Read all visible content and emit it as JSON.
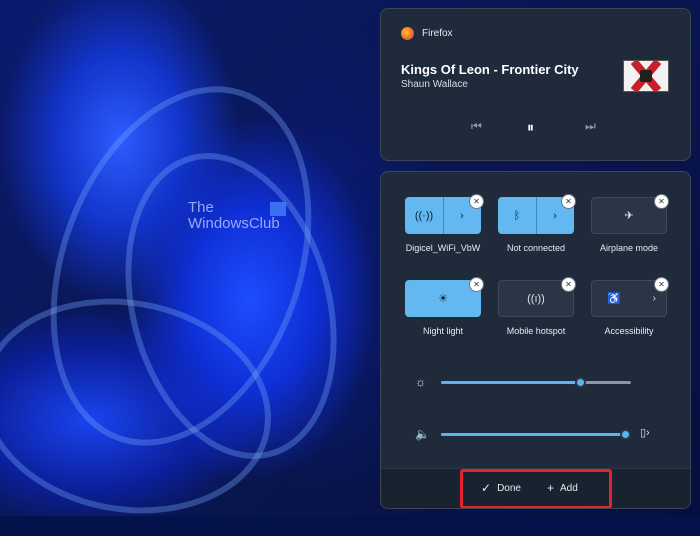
{
  "watermark": {
    "line1": "The",
    "line2": "WindowsClub"
  },
  "media": {
    "app_name": "Firefox",
    "title": "Kings Of Leon - Frontier City",
    "artist": "Shaun Wallace",
    "controls": {
      "prev": "⏮",
      "pause": "⏸",
      "next": "⏭"
    }
  },
  "tiles": [
    {
      "label": "Digicel_WiFi_VbW",
      "icon": "wifi-icon",
      "glyph": "((·))",
      "state": "on"
    },
    {
      "label": "Not connected",
      "icon": "bluetooth-icon",
      "glyph": "ᛒ",
      "state": "on"
    },
    {
      "label": "Airplane mode",
      "icon": "airplane-icon",
      "glyph": "✈",
      "state": "off"
    },
    {
      "label": "Night light",
      "icon": "night-light-icon",
      "glyph": "☀",
      "state": "on"
    },
    {
      "label": "Mobile hotspot",
      "icon": "hotspot-icon",
      "glyph": "((ı))",
      "state": "off"
    },
    {
      "label": "Accessibility",
      "icon": "accessibility-icon",
      "glyph": "♿",
      "state": "off"
    }
  ],
  "sliders": {
    "brightness": {
      "icon": "brightness-icon",
      "glyph": "☼",
      "level": 0.73
    },
    "volume": {
      "icon": "speaker-icon",
      "glyph": "🔈",
      "level": 1.0
    }
  },
  "footer": {
    "done_label": "Done",
    "add_label": "Add"
  },
  "colors": {
    "accent": "#63b8f2",
    "highlight_box": "#e8222c"
  }
}
